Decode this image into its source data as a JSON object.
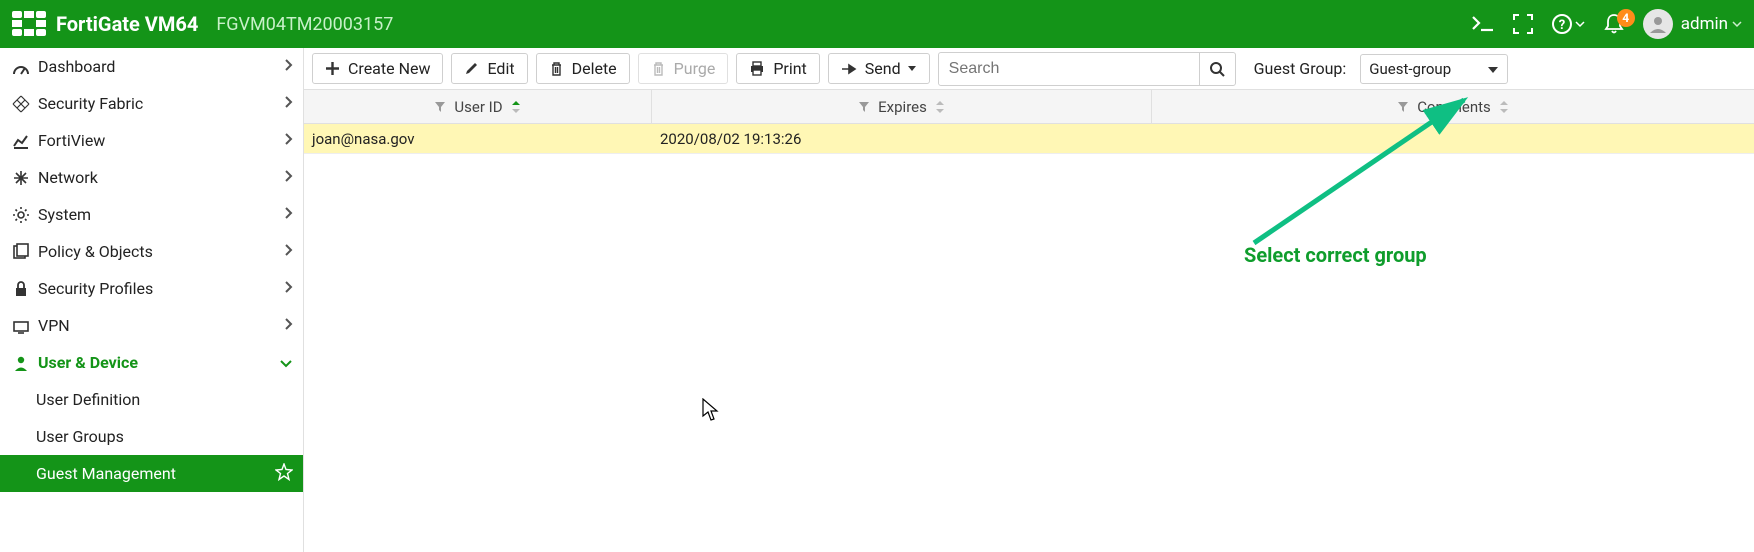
{
  "header": {
    "brand": "FortiGate VM64",
    "serial": "FGVM04TM20003157",
    "notif_count": "4",
    "user": "admin"
  },
  "sidebar": {
    "items": [
      {
        "label": "Dashboard"
      },
      {
        "label": "Security Fabric"
      },
      {
        "label": "FortiView"
      },
      {
        "label": "Network"
      },
      {
        "label": "System"
      },
      {
        "label": "Policy & Objects"
      },
      {
        "label": "Security Profiles"
      },
      {
        "label": "VPN"
      },
      {
        "label": "User & Device"
      }
    ],
    "sub_items": [
      {
        "label": "User Definition"
      },
      {
        "label": "User Groups"
      },
      {
        "label": "Guest Management"
      }
    ]
  },
  "toolbar": {
    "create": "Create New",
    "edit": "Edit",
    "delete": "Delete",
    "purge": "Purge",
    "print": "Print",
    "send": "Send",
    "search_placeholder": "Search",
    "gg_label": "Guest Group:",
    "gg_value": "Guest-group"
  },
  "table": {
    "columns": [
      "User ID",
      "Expires",
      "Comments"
    ],
    "rows": [
      {
        "user_id": "joan@nasa.gov",
        "expires": "2020/08/02 19:13:26",
        "comments": ""
      }
    ]
  },
  "annotation": {
    "text": "Select correct group"
  }
}
